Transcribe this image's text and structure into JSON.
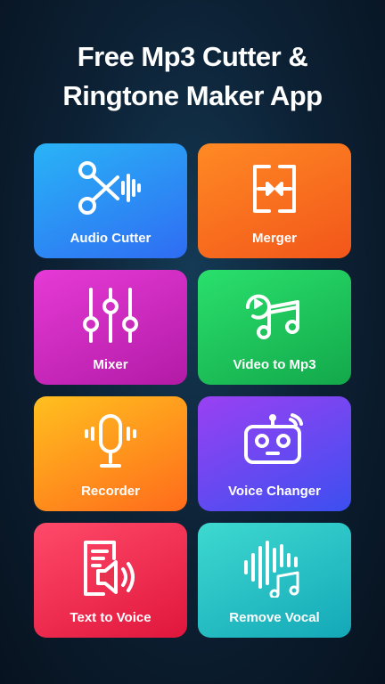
{
  "headline": {
    "line1": "Free Mp3 Cutter &",
    "line2": "Ringtone Maker App"
  },
  "tiles": [
    {
      "label": "Audio Cutter",
      "icon": "scissors-waveform-icon",
      "color_from": "#29b4f6",
      "color_to": "#2f6cf3"
    },
    {
      "label": "Merger",
      "icon": "merge-arrows-icon",
      "color_from": "#ff8a24",
      "color_to": "#f2561a"
    },
    {
      "label": "Mixer",
      "icon": "mixer-sliders-icon",
      "color_from": "#e63ad6",
      "color_to": "#b21ba6"
    },
    {
      "label": "Video to Mp3",
      "icon": "video-music-note-icon",
      "color_from": "#2ae06c",
      "color_to": "#13a84b"
    },
    {
      "label": "Recorder",
      "icon": "microphone-icon",
      "color_from": "#ffc01f",
      "color_to": "#ff6b1b"
    },
    {
      "label": "Voice Changer",
      "icon": "robot-face-icon",
      "color_from": "#9a41f2",
      "color_to": "#3c4ff0"
    },
    {
      "label": "Text to Voice",
      "icon": "document-speaker-icon",
      "color_from": "#ff4a6a",
      "color_to": "#e0163c"
    },
    {
      "label": "Remove Vocal",
      "icon": "waveform-music-note-icon",
      "color_from": "#3ed9d0",
      "color_to": "#14a8b8"
    }
  ]
}
